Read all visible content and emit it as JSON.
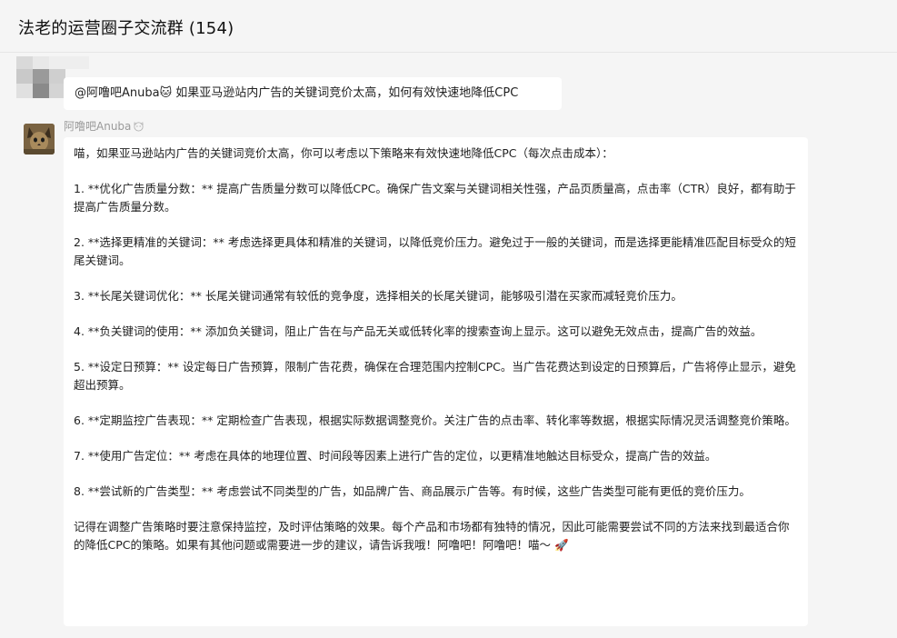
{
  "header": {
    "title": "法老的运营圈子交流群 (154)"
  },
  "message1": {
    "text": "@阿噜吧Anuba🐱 如果亚马逊站内广告的关键词竞价太高，如何有效快速地降低CPC"
  },
  "message2": {
    "sender": "阿噜吧Anuba",
    "paragraphs": [
      "喵，如果亚马逊站内广告的关键词竞价太高，你可以考虑以下策略来有效快速地降低CPC（每次点击成本）：",
      "1. **优化广告质量分数：** 提高广告质量分数可以降低CPC。确保广告文案与关键词相关性强，产品页质量高，点击率（CTR）良好，都有助于提高广告质量分数。",
      "2. **选择更精准的关键词：** 考虑选择更具体和精准的关键词，以降低竞价压力。避免过于一般的关键词，而是选择更能精准匹配目标受众的短尾关键词。",
      "3. **长尾关键词优化：** 长尾关键词通常有较低的竞争度，选择相关的长尾关键词，能够吸引潜在买家而减轻竞价压力。",
      "4. **负关键词的使用：** 添加负关键词，阻止广告在与产品无关或低转化率的搜索查询上显示。这可以避免无效点击，提高广告的效益。",
      "5. **设定日预算：** 设定每日广告预算，限制广告花费，确保在合理范围内控制CPC。当广告花费达到设定的日预算后，广告将停止显示，避免超出预算。",
      "6. **定期监控广告表现：** 定期检查广告表现，根据实际数据调整竞价。关注广告的点击率、转化率等数据，根据实际情况灵活调整竞价策略。",
      "7. **使用广告定位：** 考虑在具体的地理位置、时间段等因素上进行广告的定位，以更精准地触达目标受众，提高广告的效益。",
      "8. **尝试新的广告类型：** 考虑尝试不同类型的广告，如品牌广告、商品展示广告等。有时候，这些广告类型可能有更低的竞价压力。",
      "记得在调整广告策略时要注意保持监控，及时评估策略的效果。每个产品和市场都有独特的情况，因此可能需要尝试不同的方法来找到最适合你的降低CPC的策略。如果有其他问题或需要进一步的建议，请告诉我哦！阿噜吧！阿噜吧！喵～ 🚀"
    ]
  },
  "icons": {
    "sender_emoji": "cat-face-icon",
    "rocket": "rocket-icon"
  }
}
